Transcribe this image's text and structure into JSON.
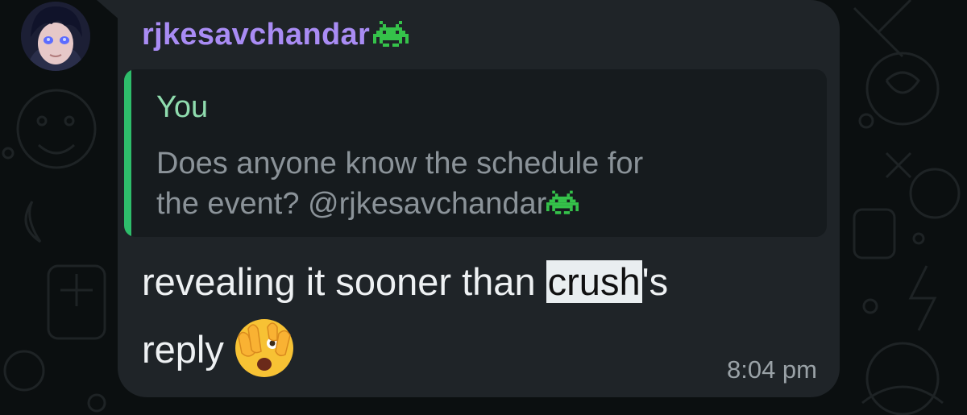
{
  "message": {
    "sender_name": "rjkesavchandar",
    "quoted_author": "You",
    "quoted_text_line1": "Does anyone know the schedule for",
    "quoted_text_line2": "the event? @rjkesavchandar",
    "text_prefix": "revealing it sooner than ",
    "text_highlight": "crush",
    "text_suffix": "'s",
    "text_line2": "reply",
    "time": "8:04 pm"
  },
  "icons": {
    "sender_badge": "alien-monster-icon",
    "emoji": "face-with-peeking-eye-icon"
  },
  "colors": {
    "sender_name": "#a98cf4",
    "quoted_author": "#8fdcae",
    "quote_bar": "#2ebd6b",
    "bubble": "#1f2428",
    "background": "#0b0f10"
  }
}
